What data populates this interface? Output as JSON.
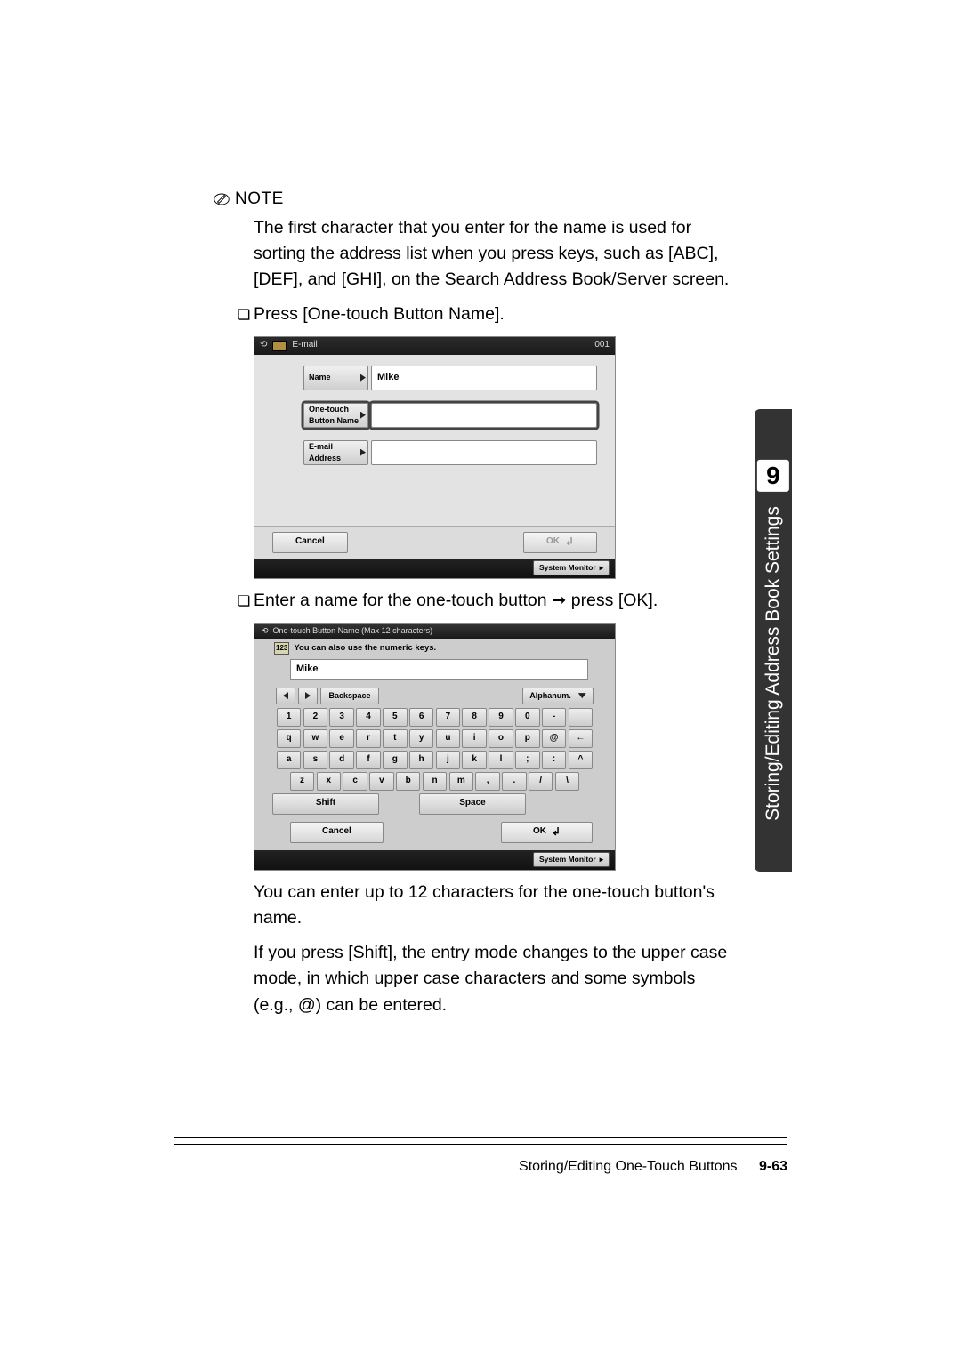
{
  "note": {
    "label": "NOTE",
    "body": "The first character that you enter for the name is used for sorting the address list when you press keys, such as [ABC], [DEF], and [GHI], on the Search Address Book/Server screen."
  },
  "step1": "Press [One-touch Button Name].",
  "screen1": {
    "titleType": "E-mail",
    "titleNum": "001",
    "labels": {
      "name": "Name",
      "nameValue": "Mike",
      "onetouch1": "One-touch",
      "onetouch2": "Button Name",
      "email1": "E-mail",
      "email2": "Address"
    },
    "cancel": "Cancel",
    "ok": "OK",
    "sysmon": "System Monitor"
  },
  "step2": "Enter a name for the one-touch button ➞ press [OK].",
  "kb": {
    "title": "One-touch Button Name (Max 12 characters)",
    "hint": "You can also use the numeric keys.",
    "value": "Mike",
    "backspace": "Backspace",
    "mode": "Alphanum.",
    "row1": [
      "1",
      "2",
      "3",
      "4",
      "5",
      "6",
      "7",
      "8",
      "9",
      "0",
      "-",
      "_"
    ],
    "row2": [
      "q",
      "w",
      "e",
      "r",
      "t",
      "y",
      "u",
      "i",
      "o",
      "p",
      "@",
      "←"
    ],
    "row3": [
      "a",
      "s",
      "d",
      "f",
      "g",
      "h",
      "j",
      "k",
      "l",
      ";",
      ":",
      "^"
    ],
    "row4": [
      "z",
      "x",
      "c",
      "v",
      "b",
      "n",
      "m",
      ",",
      ".",
      "/",
      "\\"
    ],
    "shift": "Shift",
    "space": "Space",
    "cancel": "Cancel",
    "ok": "OK",
    "sysmon": "System Monitor"
  },
  "follow1": "You can enter up to 12 characters for the one-touch button's name.",
  "follow2": "If you press [Shift], the entry mode changes to the upper case mode, in which upper case characters and some symbols (e.g., @) can be entered.",
  "sideTab": {
    "num": "9",
    "label": "Storing/Editing Address Book Settings"
  },
  "footer": {
    "section": "Storing/Editing One-Touch Buttons",
    "page": "9-63"
  }
}
